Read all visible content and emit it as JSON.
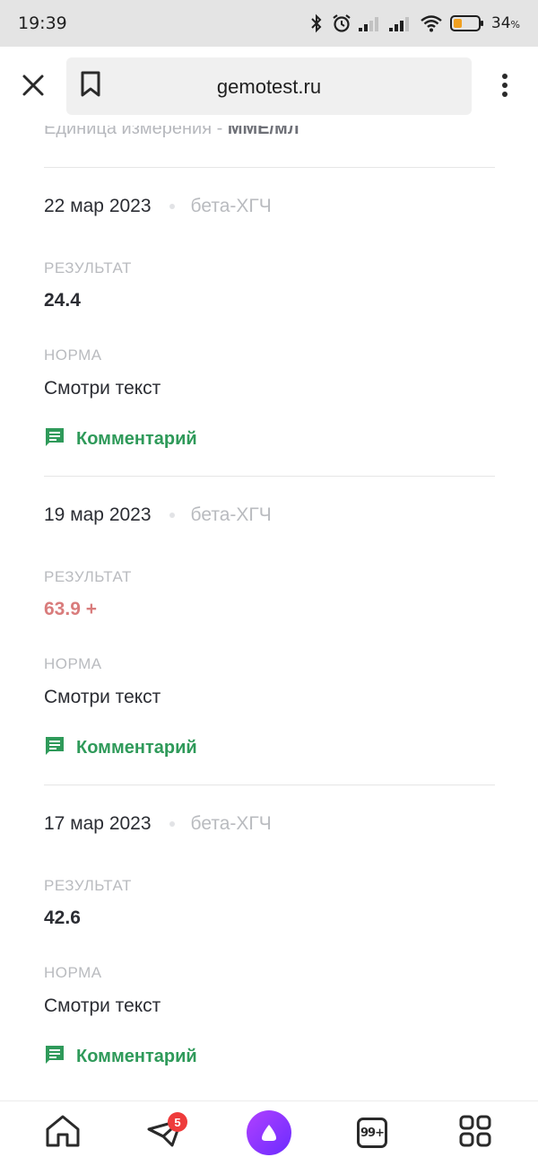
{
  "status_bar": {
    "time": "19:39",
    "battery_percent": "34",
    "battery_suffix": "%",
    "battery_level": 0.34,
    "battery_color": "#f0a020"
  },
  "browser": {
    "url": "gemotest.ru",
    "close_icon": "close-icon",
    "bookmark_icon": "bookmark-icon",
    "menu_icon": "more-vertical-icon"
  },
  "unit_line": {
    "label": "Единица измерения - ",
    "value": "ММЕ/мл"
  },
  "results": [
    {
      "date": "22 мар 2023",
      "test": "бета-ХГЧ",
      "result_label": "РЕЗУЛЬТАТ",
      "result_value": "24.4",
      "abnormal": false,
      "norm_label": "НОРМА",
      "norm_value": "Смотри текст",
      "comment_label": "Комментарий"
    },
    {
      "date": "19 мар 2023",
      "test": "бета-ХГЧ",
      "result_label": "РЕЗУЛЬТАТ",
      "result_value": "63.9 +",
      "abnormal": true,
      "norm_label": "НОРМА",
      "norm_value": "Смотри текст",
      "comment_label": "Комментарий"
    },
    {
      "date": "17 мар 2023",
      "test": "бета-ХГЧ",
      "result_label": "РЕЗУЛЬТАТ",
      "result_value": "42.6",
      "abnormal": false,
      "norm_label": "НОРМА",
      "norm_value": "Смотри текст",
      "comment_label": "Комментарий"
    }
  ],
  "colors": {
    "accent_green": "#2f9a5a",
    "abnormal_red": "#d97c7c",
    "alice_purple": "#8a3cff",
    "badge_red": "#ee3b3b"
  },
  "bottom_nav": {
    "home_icon": "home-icon",
    "messenger_icon": "paper-plane-icon",
    "messenger_badge": "5",
    "alice_icon": "alice-voice-assistant-icon",
    "tabs_count": "99+",
    "services_icon": "grid-icon"
  }
}
